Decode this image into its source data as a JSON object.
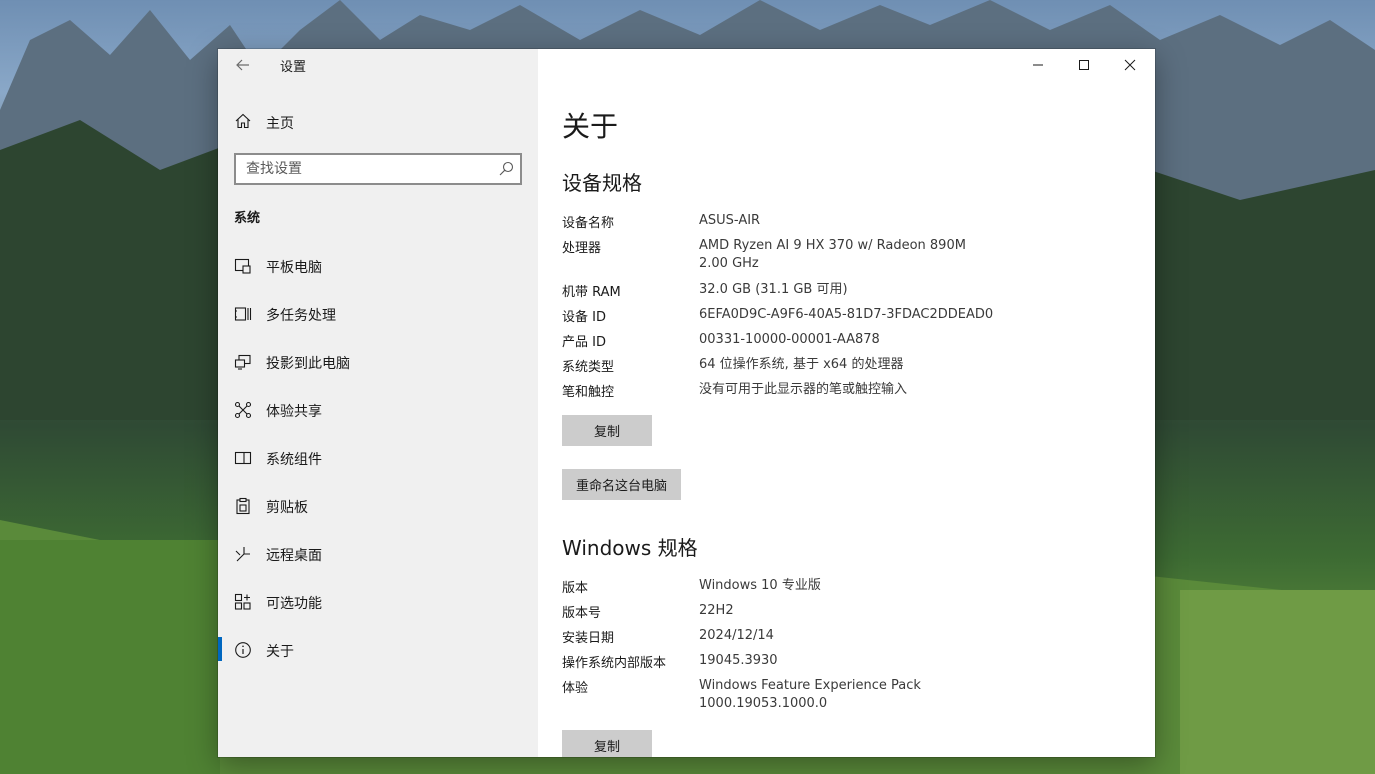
{
  "window": {
    "title": "设置"
  },
  "sidebar": {
    "home_label": "主页",
    "search_placeholder": "查找设置",
    "section": "系统",
    "items": [
      {
        "label": "平板电脑",
        "icon": "tablet-icon"
      },
      {
        "label": "多任务处理",
        "icon": "multitasking-icon"
      },
      {
        "label": "投影到此电脑",
        "icon": "project-icon"
      },
      {
        "label": "体验共享",
        "icon": "share-icon"
      },
      {
        "label": "系统组件",
        "icon": "components-icon"
      },
      {
        "label": "剪贴板",
        "icon": "clipboard-icon"
      },
      {
        "label": "远程桌面",
        "icon": "remote-desktop-icon"
      },
      {
        "label": "可选功能",
        "icon": "optional-features-icon"
      },
      {
        "label": "关于",
        "icon": "info-icon",
        "active": true
      }
    ]
  },
  "main": {
    "title": "关于",
    "device_specs": {
      "heading": "设备规格",
      "rows": [
        {
          "key": "设备名称",
          "value": "ASUS-AIR"
        },
        {
          "key": "处理器",
          "value": "AMD Ryzen AI 9 HX 370 w/ Radeon 890M\n2.00 GHz"
        },
        {
          "key": "机带 RAM",
          "value": "32.0 GB (31.1 GB 可用)"
        },
        {
          "key": "设备 ID",
          "value": "6EFA0D9C-A9F6-40A5-81D7-3FDAC2DDEAD0"
        },
        {
          "key": "产品 ID",
          "value": "00331-10000-00001-AA878"
        },
        {
          "key": "系统类型",
          "value": "64 位操作系统, 基于 x64 的处理器"
        },
        {
          "key": "笔和触控",
          "value": "没有可用于此显示器的笔或触控输入"
        }
      ],
      "copy_label": "复制",
      "rename_label": "重命名这台电脑"
    },
    "windows_specs": {
      "heading": "Windows 规格",
      "rows": [
        {
          "key": "版本",
          "value": "Windows 10 专业版"
        },
        {
          "key": "版本号",
          "value": "22H2"
        },
        {
          "key": "安装日期",
          "value": "2024/12/14"
        },
        {
          "key": "操作系统内部版本",
          "value": "19045.3930"
        },
        {
          "key": "体验",
          "value": "Windows Feature Experience Pack\n1000.19053.1000.0"
        }
      ],
      "copy_label": "复制"
    }
  },
  "colors": {
    "accent": "#0067c0",
    "sidebar_bg": "#f0f0f0",
    "button_bg": "#cccccc"
  }
}
